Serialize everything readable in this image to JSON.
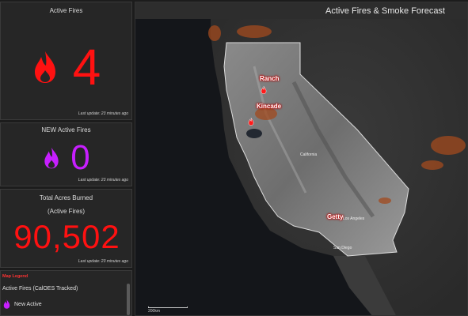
{
  "panels": {
    "active": {
      "title": "Active Fires",
      "value": "4",
      "update": "Last update: 23 minutes ago",
      "color": "#ff1111"
    },
    "new": {
      "title": "NEW Active Fires",
      "value": "0",
      "update": "Last update: 23 minutes ago",
      "color": "#c71fff"
    },
    "acres": {
      "title_line1": "Total Acres Burned",
      "title_line2": "(Active Fires)",
      "value": "90,502",
      "update": "Last update: 23 minutes ago",
      "color": "#ff1111"
    },
    "legend": {
      "title": "Map Legend",
      "subtitle": "Active Fires (CalOES Tracked)",
      "items": [
        {
          "label": "New Active",
          "icon": "flame-icon",
          "color": "#c71fff"
        }
      ]
    }
  },
  "map": {
    "title": "Active Fires & Smoke Forecast",
    "fires": [
      {
        "label": "Ranch"
      },
      {
        "label": "Kincade"
      },
      {
        "label": "Getty"
      }
    ],
    "cities": [
      "California",
      "Los Angeles",
      "San Diego"
    ],
    "scale": "200km"
  }
}
